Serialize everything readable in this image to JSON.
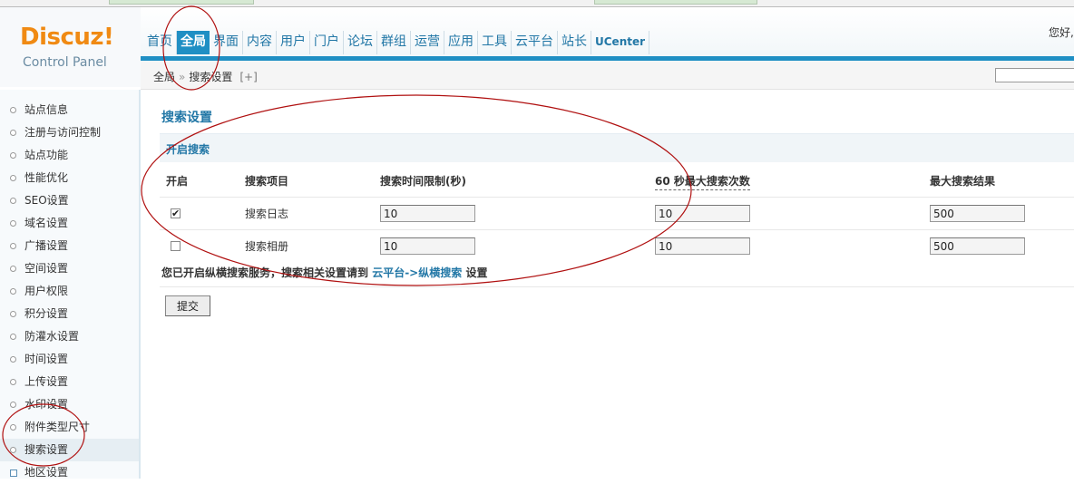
{
  "logo": {
    "brand": "Discuz!",
    "subtitle": "Control Panel"
  },
  "nav": [
    "首页",
    "全局",
    "界面",
    "内容",
    "用户",
    "门户",
    "论坛",
    "群组",
    "运营",
    "应用",
    "工具",
    "云平台",
    "站长",
    "UCenter"
  ],
  "greeting": "您好,",
  "breadcrumb": {
    "parent": "全局",
    "sep": "»",
    "current": "搜索设置",
    "add": "[+]"
  },
  "sidebar": [
    "站点信息",
    "注册与访问控制",
    "站点功能",
    "性能优化",
    "SEO设置",
    "域名设置",
    "广播设置",
    "空间设置",
    "用户权限",
    "积分设置",
    "防灌水设置",
    "时间设置",
    "上传设置",
    "水印设置",
    "附件类型尺寸",
    "搜索设置",
    "地区设置"
  ],
  "page": {
    "title": "搜索设置",
    "section": "开启搜索",
    "headers": [
      "开启",
      "搜索项目",
      "搜索时间限制(秒)",
      "60 秒最大搜索次数",
      "最大搜索结果"
    ],
    "rows": [
      {
        "enabled": "✔",
        "name": "搜索日志",
        "time_limit": "10",
        "max_count": "10",
        "max_results": "500"
      },
      {
        "enabled": "",
        "name": "搜索相册",
        "time_limit": "10",
        "max_count": "10",
        "max_results": "500"
      }
    ],
    "notice": {
      "prefix": "您已开启纵横搜索服务，搜索相关设置请到",
      "link": "云平台->纵横搜索",
      "suffix": "设置"
    },
    "submit": "提交"
  },
  "colors": {
    "accent": "#1f8fc4",
    "link": "#2277a6",
    "logo": "#f08a13",
    "annotation": "#b01010"
  }
}
